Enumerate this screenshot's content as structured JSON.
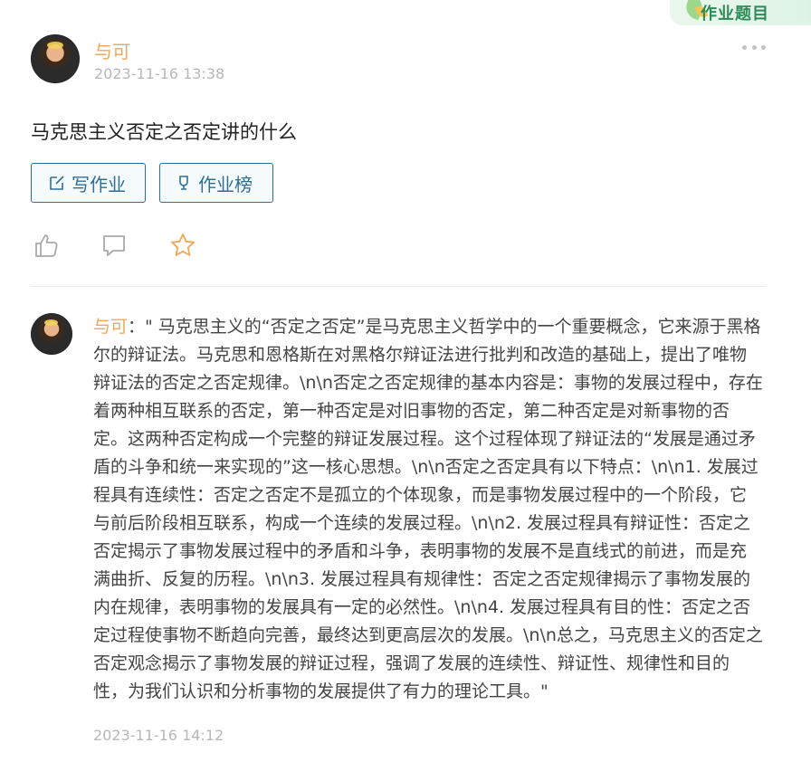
{
  "corner_tab": {
    "label": "作业题目"
  },
  "question": {
    "author": "与可",
    "timestamp": "2023-11-16 13:38",
    "text": "马克思主义否定之否定讲的什么",
    "buttons": {
      "write_homework": "写作业",
      "homework_rank": "作业榜"
    },
    "icons": [
      "thumb-up-icon",
      "comment-icon",
      "star-icon",
      "more-icon"
    ],
    "colors": {
      "author": "#f0a858",
      "button": "#2f6f95",
      "star": "#f0a858"
    }
  },
  "answer": {
    "author": "与可",
    "separator": "：",
    "text": "\" 马克思主义的“否定之否定”是马克思主义哲学中的一个重要概念，它来源于黑格尔的辩证法。马克思和恩格斯在对黑格尔辩证法进行批判和改造的基础上，提出了唯物辩证法的否定之否定规律。\\n\\n否定之否定规律的基本内容是：事物的发展过程中，存在着两种相互联系的否定，第一种否定是对旧事物的否定，第二种否定是对新事物的否定。这两种否定构成一个完整的辩证发展过程。这个过程体现了辩证法的“发展是通过矛盾的斗争和统一来实现的”这一核心思想。\\n\\n否定之否定具有以下特点：\\n\\n1. 发展过程具有连续性：否定之否定不是孤立的个体现象，而是事物发展过程中的一个阶段，它与前后阶段相互联系，构成一个连续的发展过程。\\n\\n2. 发展过程具有辩证性：否定之否定揭示了事物发展过程中的矛盾和斗争，表明事物的发展不是直线式的前进，而是充满曲折、反复的历程。\\n\\n3. 发展过程具有规律性：否定之否定规律揭示了事物发展的内在规律，表明事物的发展具有一定的必然性。\\n\\n4. 发展过程具有目的性：否定之否定过程使事物不断趋向完善，最终达到更高层次的发展。\\n\\n总之，马克思主义的否定之否定观念揭示了事物发展的辩证过程，强调了发展的连续性、辩证性、规律性和目的性，为我们认识和分析事物的发展提供了有力的理论工具。\"",
    "timestamp": "2023-11-16 14:12"
  }
}
